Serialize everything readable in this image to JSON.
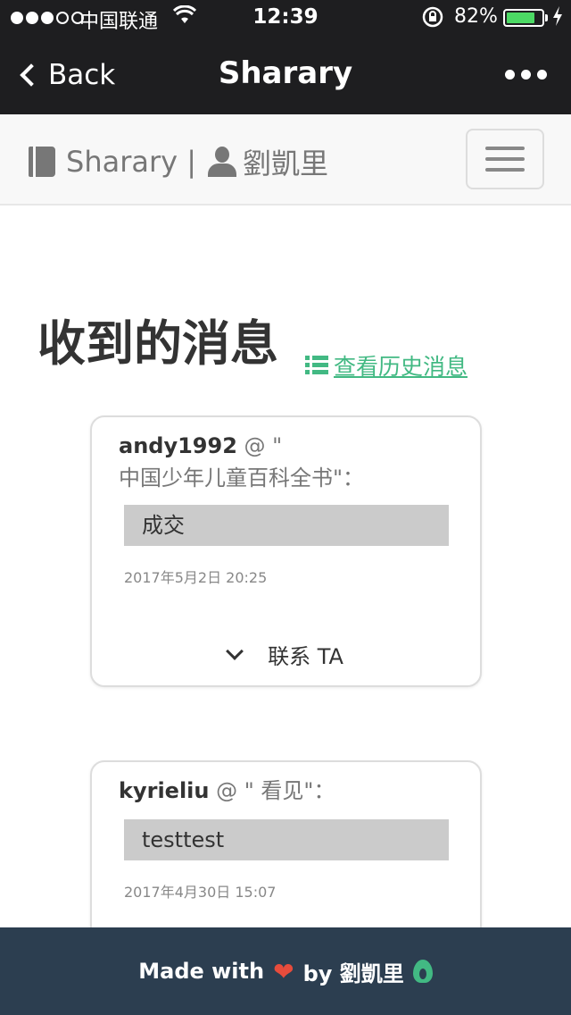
{
  "status": {
    "carrier": "中国联通",
    "time": "12:39",
    "battery": "82%",
    "battery_level": 0.82,
    "signal_bars": 3,
    "signal_total": 5
  },
  "nav": {
    "back_label": "Back",
    "title": "Sharary"
  },
  "site": {
    "brand": "Sharary |",
    "user": "劉凱里"
  },
  "page": {
    "title": "收到的消息",
    "history_link": "查看历史消息"
  },
  "messages": [
    {
      "sender": "andy1992",
      "at": " @ \"",
      "subject": "中国少年儿童百科全书\"：",
      "text": "成交",
      "time": "2017年5月2日 20:25",
      "action": "联系 TA"
    },
    {
      "sender": "kyrieliu",
      "at": " @ \"",
      "subject": " 看见\"：",
      "text": "testtest",
      "time": "2017年4月30日 15:07"
    }
  ],
  "footer": {
    "made_with": "Made with",
    "by": "by 劉凱里"
  },
  "colors": {
    "header_bg": "#1e1e20",
    "accent_green": "#42b983",
    "footer_bg": "#2c3e50",
    "heart": "#e74c3c",
    "battery": "#4cd964"
  }
}
